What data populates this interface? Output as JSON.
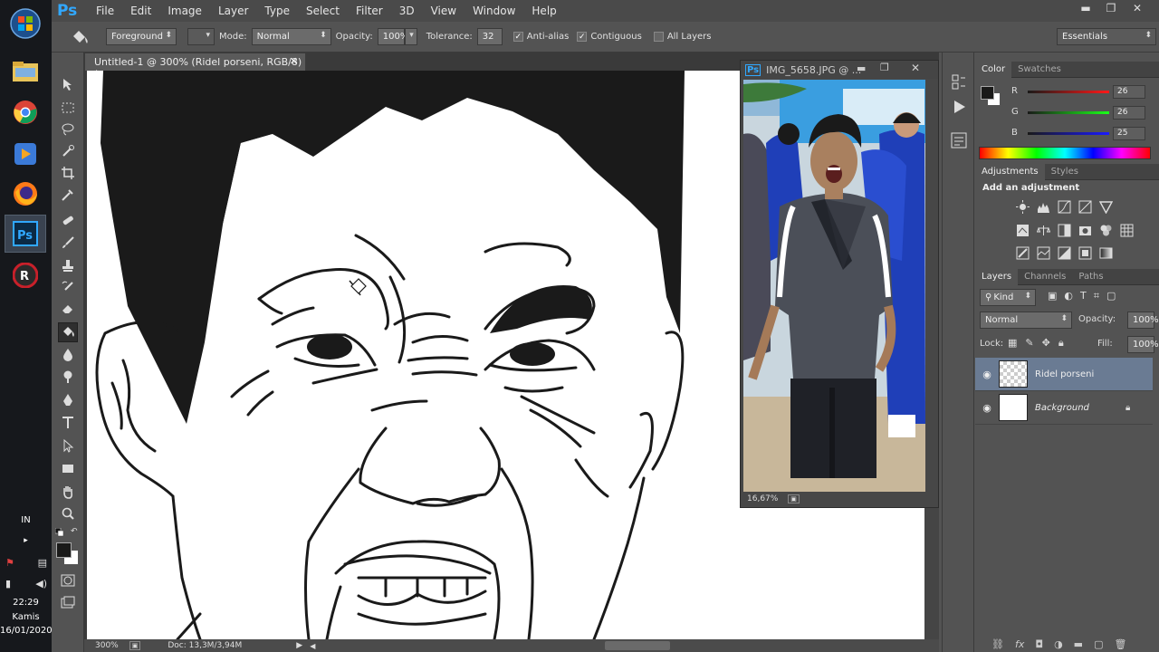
{
  "taskbar": {
    "lang": "IN",
    "time": "22:29",
    "day": "Kamis",
    "date": "16/01/2020"
  },
  "menubar": {
    "logo": "Ps",
    "items": [
      "File",
      "Edit",
      "Image",
      "Layer",
      "Type",
      "Select",
      "Filter",
      "3D",
      "View",
      "Window",
      "Help"
    ]
  },
  "options": {
    "fill_source": "Foreground",
    "mode_label": "Mode:",
    "mode_value": "Normal",
    "opacity_label": "Opacity:",
    "opacity_value": "100%",
    "tolerance_label": "Tolerance:",
    "tolerance_value": "32",
    "antialias_label": "Anti-alias",
    "contiguous_label": "Contiguous",
    "alllayers_label": "All Layers",
    "workspace": "Essentials"
  },
  "document": {
    "tab_title": "Untitled-1 @ 300% (Ridel porseni, RGB/8) *",
    "zoom": "300%",
    "doc_size": "Doc: 13,3M/3,94M"
  },
  "photo_window": {
    "title": "IMG_5658.JPG @ ...",
    "zoom": "16,67%"
  },
  "color_panel": {
    "tabs": [
      "Color",
      "Swatches"
    ],
    "r_label": "R",
    "g_label": "G",
    "b_label": "B",
    "r": "26",
    "g": "26",
    "b": "25"
  },
  "adjustments_panel": {
    "tabs": [
      "Adjustments",
      "Styles"
    ],
    "heading": "Add an adjustment"
  },
  "layers_panel": {
    "tabs": [
      "Layers",
      "Channels",
      "Paths"
    ],
    "filter": "Kind",
    "blend_mode": "Normal",
    "opacity_label": "Opacity:",
    "opacity_value": "100%",
    "lock_label": "Lock:",
    "fill_label": "Fill:",
    "fill_value": "100%",
    "layers": [
      {
        "name": "Ridel porseni"
      },
      {
        "name": "Background"
      }
    ]
  },
  "colors": {
    "ps_blue": "#31a8ff",
    "selected_layer": "#6a7b93",
    "ui_gray": "#535353"
  }
}
